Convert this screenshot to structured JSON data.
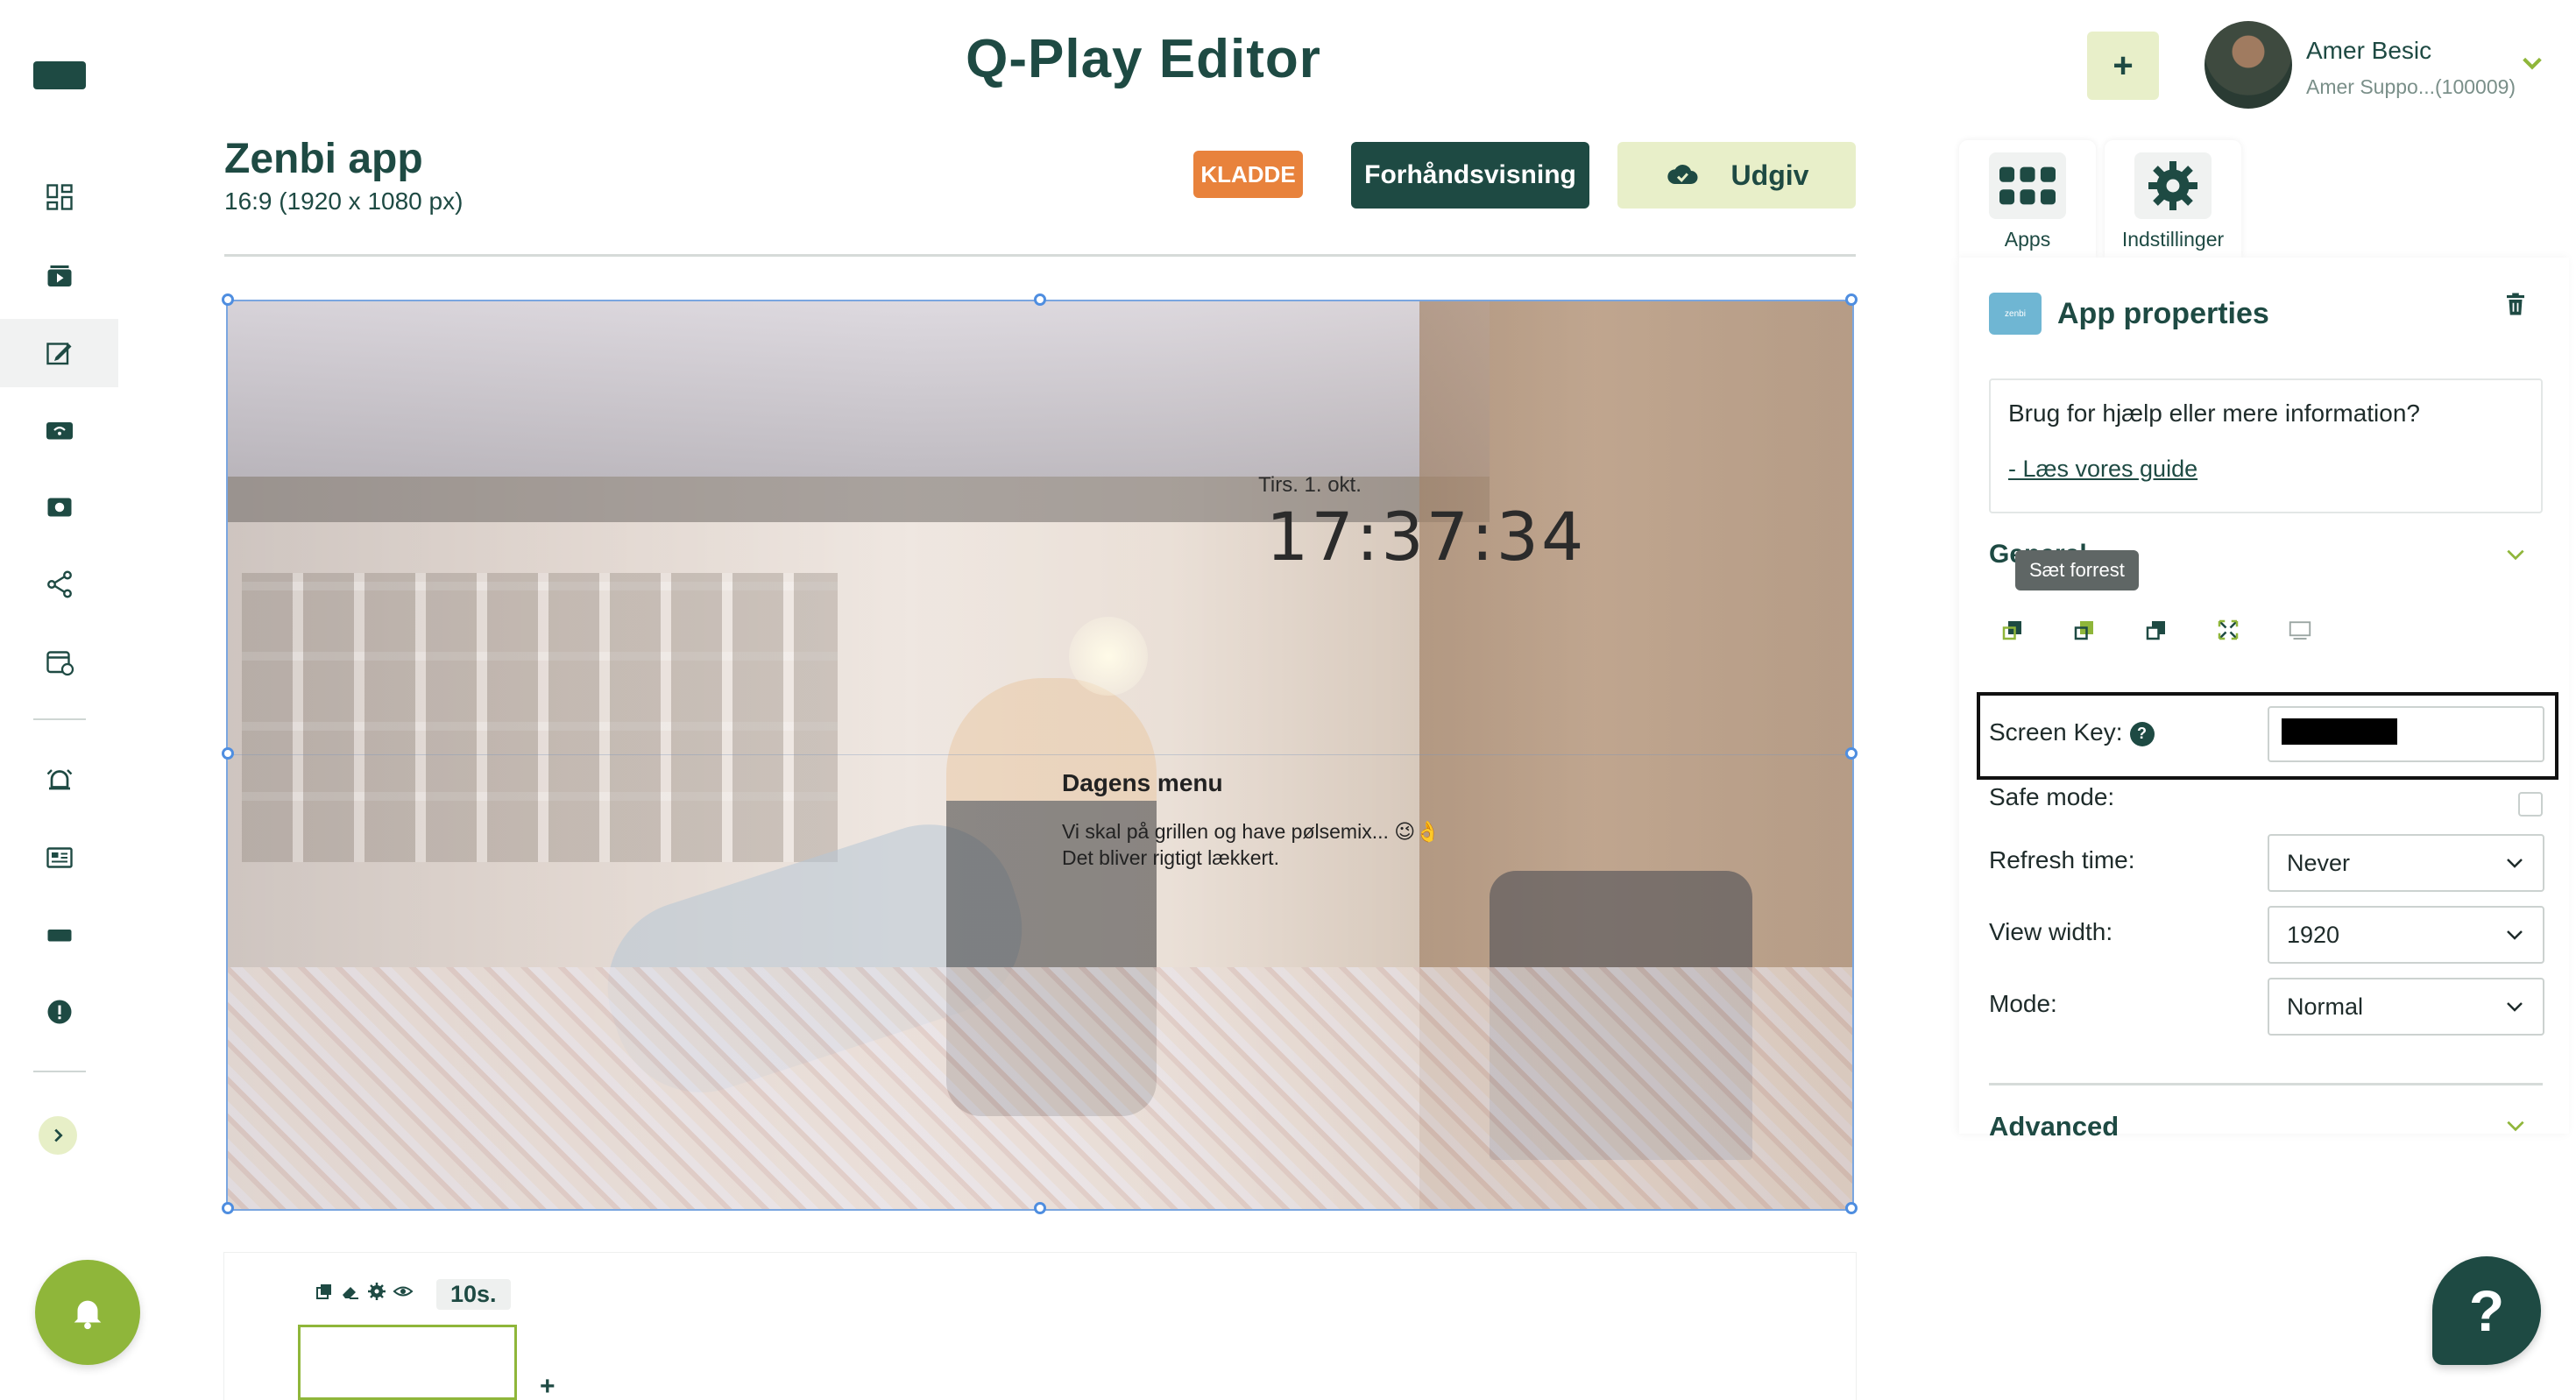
{
  "header": {
    "app_title": "Q-Play Editor",
    "add_label": "+",
    "user_name": "Amer Besic",
    "user_sub": "Amer Suppo...(100009)"
  },
  "document": {
    "title": "Zenbi app",
    "size": "16:9 (1920 x 1080 px)",
    "status_badge": "KLADDE",
    "preview_label": "Forhåndsvisning",
    "publish_label": "Udgiv"
  },
  "canvas": {
    "date": "Tirs. 1. okt.",
    "clock": "17:37:34",
    "menu_title": "Dagens menu",
    "menu_line1": "Vi skal på grillen og have pølsemix... 😉👌",
    "menu_line2": "Det bliver rigtigt lækkert."
  },
  "timeline": {
    "duration": "10s.",
    "add_label": "+"
  },
  "tabs": [
    {
      "label": "Apps",
      "icon": "apps-grid-icon"
    },
    {
      "label": "Indstillinger",
      "icon": "gear-icon"
    }
  ],
  "properties": {
    "title": "App properties",
    "logo_text": "zenbi",
    "help_question": "Brug for hjælp eller mere information?",
    "help_link": "- Læs vores guide",
    "general_label": "General",
    "tooltip": "Sæt forrest",
    "screen_key_label": "Screen Key:",
    "screen_key_help": "?",
    "safe_mode_label": "Safe mode:",
    "refresh_label": "Refresh time:",
    "refresh_value": "Never",
    "view_width_label": "View width:",
    "view_width_value": "1920",
    "mode_label": "Mode:",
    "mode_value": "Normal",
    "advanced_label": "Advanced"
  },
  "help_fab": "?",
  "colors": {
    "brand": "#1e4a43",
    "accent_green": "#8fb63a",
    "light_green": "#e8efc9",
    "draft_orange": "#e8823c"
  }
}
